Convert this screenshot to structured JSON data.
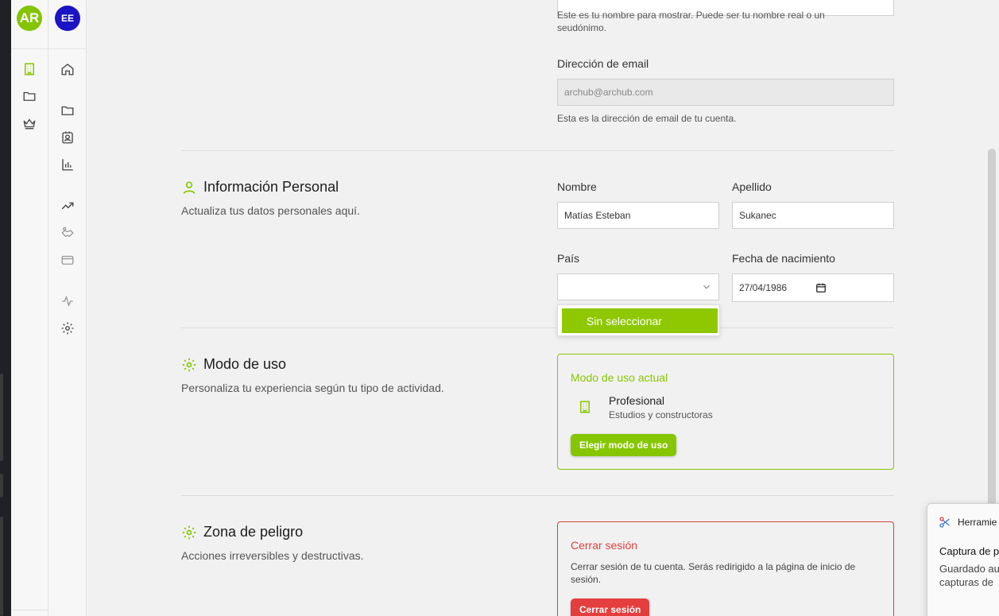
{
  "sidebar_primary": {
    "avatar_initials": "AR",
    "items": [
      {
        "icon": "building-icon",
        "active": true
      },
      {
        "icon": "folder-icon",
        "active": false
      },
      {
        "icon": "crown-icon",
        "active": false
      }
    ]
  },
  "sidebar_secondary": {
    "avatar_initials": "EE",
    "items": [
      {
        "icon": "home-icon"
      },
      {
        "icon": "folder-icon"
      },
      {
        "icon": "contact-card-icon"
      },
      {
        "icon": "bar-chart-icon"
      },
      {
        "icon": "trending-up-icon"
      },
      {
        "icon": "handshake-icon"
      },
      {
        "icon": "credit-card-icon"
      },
      {
        "icon": "activity-icon"
      },
      {
        "icon": "settings-icon"
      }
    ]
  },
  "account": {
    "display_name_hint": "Este es tu nombre para mostrar. Puede ser tu nombre real o un seudónimo.",
    "email_label": "Dirección de email",
    "email_value": "archub@archub.com",
    "email_hint": "Esta es la dirección de email de tu cuenta."
  },
  "personal": {
    "title": "Información Personal",
    "description": "Actualiza tus datos personales aquí.",
    "first_name_label": "Nombre",
    "first_name_value": "Matías Esteban",
    "last_name_label": "Apellido",
    "last_name_value": "Sukanec",
    "country_label": "País",
    "country_value": "",
    "country_option": "Sin seleccionar",
    "birthdate_label": "Fecha de nacimiento",
    "birthdate_value": "27/04/1986"
  },
  "usage": {
    "title": "Modo de uso",
    "description": "Personaliza tu experiencia según tu tipo de actividad.",
    "card_title": "Modo de uso actual",
    "mode_name": "Profesional",
    "mode_desc": "Estudios y constructoras",
    "button": "Elegir modo de uso"
  },
  "danger": {
    "title": "Zona de peligro",
    "description": "Acciones irreversibles y destructivas.",
    "card_title": "Cerrar sesión",
    "card_text": "Cerrar sesión de tu cuenta. Serás redirigido a la página de inicio de sesión.",
    "button": "Cerrar sesión"
  },
  "toast": {
    "app": "Herramie",
    "title": "Captura de p",
    "line1": "Guardado au",
    "line2": "capturas de"
  },
  "colors": {
    "accent": "#86c600",
    "danger": "#e53e3e",
    "avatar_ee": "#1a14c4"
  }
}
